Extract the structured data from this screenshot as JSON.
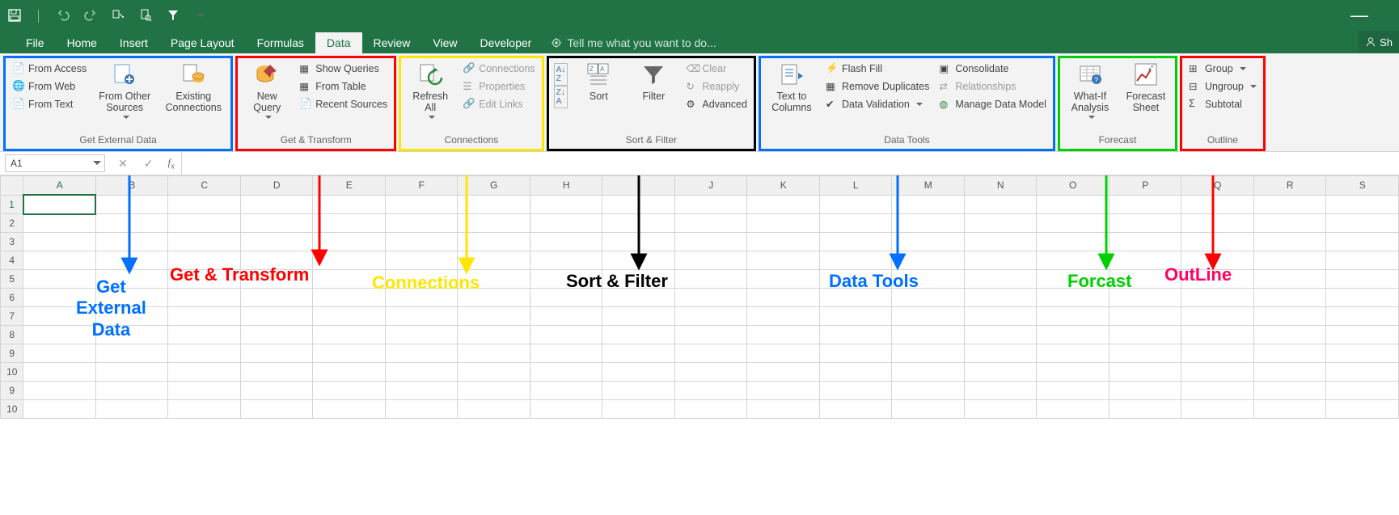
{
  "qat_hint": "Customize Quick Access Toolbar",
  "tabs": {
    "file": "File",
    "home": "Home",
    "insert": "Insert",
    "pagelayout": "Page Layout",
    "formulas": "Formulas",
    "data": "Data",
    "review": "Review",
    "view": "View",
    "developer": "Developer"
  },
  "tell_me_placeholder": "Tell me what you want to do...",
  "share_label": "Sh",
  "name_box": "A1",
  "ribbon": {
    "get_external": {
      "label": "Get External Data",
      "from_access": "From Access",
      "from_web": "From Web",
      "from_text": "From Text",
      "from_other": "From Other Sources",
      "existing": "Existing Connections"
    },
    "get_transform": {
      "label": "Get & Transform",
      "new_query": "New Query",
      "show_queries": "Show Queries",
      "from_table": "From Table",
      "recent": "Recent Sources"
    },
    "connections": {
      "label": "Connections",
      "refresh": "Refresh All",
      "connections": "Connections",
      "properties": "Properties",
      "edit_links": "Edit Links"
    },
    "sort_filter": {
      "label": "Sort & Filter",
      "sort": "Sort",
      "filter": "Filter",
      "clear": "Clear",
      "reapply": "Reapply",
      "advanced": "Advanced"
    },
    "data_tools": {
      "label": "Data Tools",
      "text_to_columns": "Text to Columns",
      "flash_fill": "Flash Fill",
      "remove_dup": "Remove Duplicates",
      "validation": "Data Validation",
      "consolidate": "Consolidate",
      "relationships": "Relationships",
      "manage_model": "Manage Data Model"
    },
    "forecast": {
      "label": "Forecast",
      "whatif": "What-If Analysis",
      "forecast_sheet": "Forecast Sheet"
    },
    "outline": {
      "label": "Outline",
      "group": "Group",
      "ungroup": "Ungroup",
      "subtotal": "Subtotal"
    }
  },
  "columns": [
    "A",
    "B",
    "C",
    "D",
    "E",
    "F",
    "G",
    "H",
    "I",
    "J",
    "K",
    "L",
    "M",
    "N",
    "O",
    "P",
    "Q",
    "R",
    "S"
  ],
  "rows": [
    "1",
    "2",
    "3",
    "4",
    "5",
    "6",
    "7",
    "8",
    "9",
    "10",
    "9",
    "10"
  ],
  "annotations": {
    "get_external": "Get External Data",
    "get_transform": "Get & Transform",
    "connections": "Connections",
    "sort_filter": "Sort & Filter",
    "data_tools": "Data Tools",
    "forecast": "Forcast",
    "outline": "OutLine"
  },
  "colors": {
    "blue": "#0070ff",
    "red": "#ff0000",
    "yellow": "#ffe600",
    "black": "#000000",
    "green": "#00d000",
    "magenta": "#ff0066",
    "excel_green": "#217346"
  }
}
